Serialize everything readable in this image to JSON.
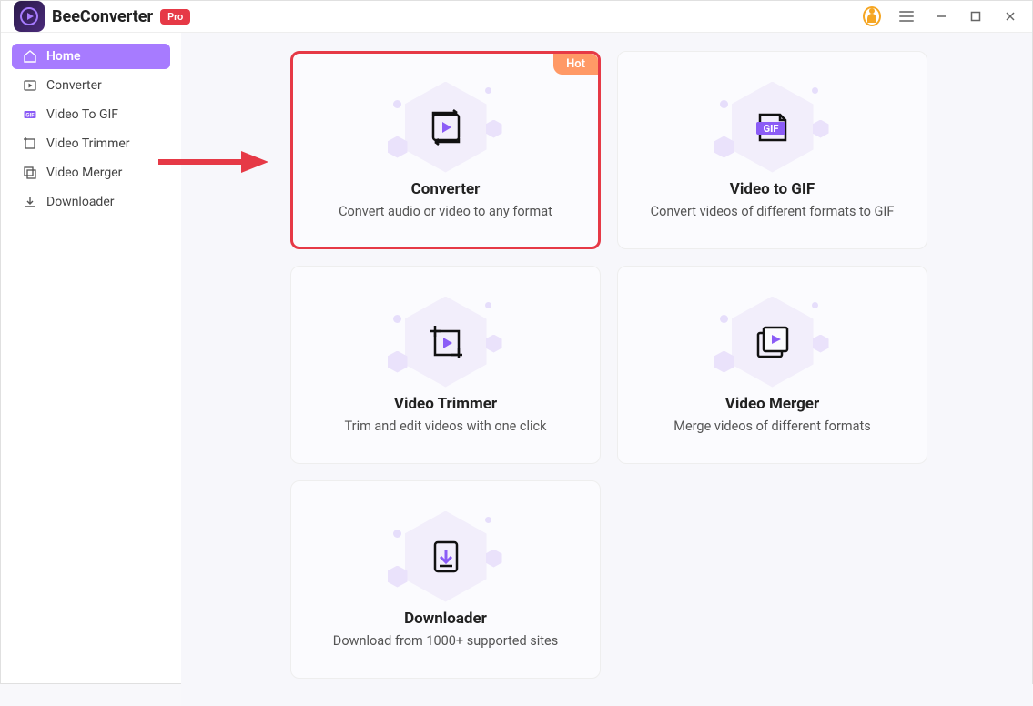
{
  "app": {
    "title": "BeeConverter",
    "pro_badge": "Pro"
  },
  "sidebar": {
    "items": [
      {
        "label": "Home",
        "icon": "home"
      },
      {
        "label": "Converter",
        "icon": "play-box"
      },
      {
        "label": "Video To GIF",
        "icon": "gif"
      },
      {
        "label": "Video Trimmer",
        "icon": "trim"
      },
      {
        "label": "Video Merger",
        "icon": "merge"
      },
      {
        "label": "Downloader",
        "icon": "download"
      }
    ]
  },
  "cards": [
    {
      "title": "Converter",
      "desc": "Convert audio or video to any format",
      "badge": "Hot"
    },
    {
      "title": "Video to GIF",
      "desc": "Convert videos of different formats to GIF"
    },
    {
      "title": "Video Trimmer",
      "desc": "Trim and edit videos with one click"
    },
    {
      "title": "Video Merger",
      "desc": "Merge videos of different formats"
    },
    {
      "title": "Downloader",
      "desc": "Download from 1000+ supported sites"
    }
  ]
}
